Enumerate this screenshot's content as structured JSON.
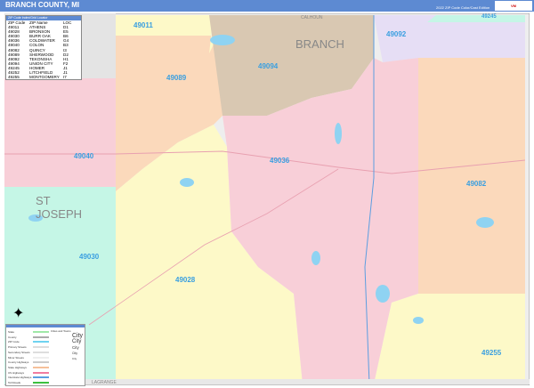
{
  "header": {
    "title": "BRANCH COUNTY, MI",
    "edition": "2022 ZIP Code Color/Cast Edition",
    "logo": "Vector Maps"
  },
  "zip_table": {
    "caption": "ZIP Code Index/Grid Locator",
    "headers": [
      "ZIP Code",
      "ZIP Name",
      "LOC"
    ],
    "rows": [
      [
        "49011",
        "ATHENS",
        "D1"
      ],
      [
        "49028",
        "BRONSON",
        "E5"
      ],
      [
        "49030",
        "BURR OAK",
        "B6"
      ],
      [
        "49036",
        "COLDWATER",
        "G4"
      ],
      [
        "49040",
        "COLON",
        "B3"
      ],
      [
        "49082",
        "QUINCY",
        "I3"
      ],
      [
        "49089",
        "SHERWOOD",
        "D2"
      ],
      [
        "49092",
        "TEKONSHA",
        "H1"
      ],
      [
        "49094",
        "UNION CITY",
        "F2"
      ],
      [
        "49245",
        "HOMER",
        "J1"
      ],
      [
        "49252",
        "LITCHFIELD",
        "J1"
      ],
      [
        "49255",
        "MONTGOMERY",
        "I7"
      ]
    ]
  },
  "zip_labels": [
    "49011",
    "49092",
    "49094",
    "49089",
    "49040",
    "49036",
    "49082",
    "49030",
    "49028",
    "49255",
    "49245"
  ],
  "county_labels": {
    "branch": "BRANCH",
    "st_joseph": "ST JOSEPH",
    "lagrange": "LAGRANGE",
    "calhoun": "CALHOUN"
  },
  "legend": {
    "items": [
      "State",
      "County",
      "ZIP Code",
      "Primary Streets",
      "Secondary Streets",
      "Minor Streets",
      "County Highways",
      "State Highways",
      "US Highways",
      "Interstate Highways",
      "Toll Roads"
    ],
    "city_sizes": [
      "City",
      "City",
      "City",
      "City",
      "City"
    ],
    "city_caption": "Cities and Towns"
  },
  "colors": {
    "yellow": "#fdf9c8",
    "peach": "#fbd9bb",
    "pink": "#f8cfd8",
    "mint": "#c5f6e6",
    "tan": "#d9c8b2",
    "lavender": "#e6def5",
    "water": "#8fd3f2",
    "zipline": "#6fd3f0"
  }
}
